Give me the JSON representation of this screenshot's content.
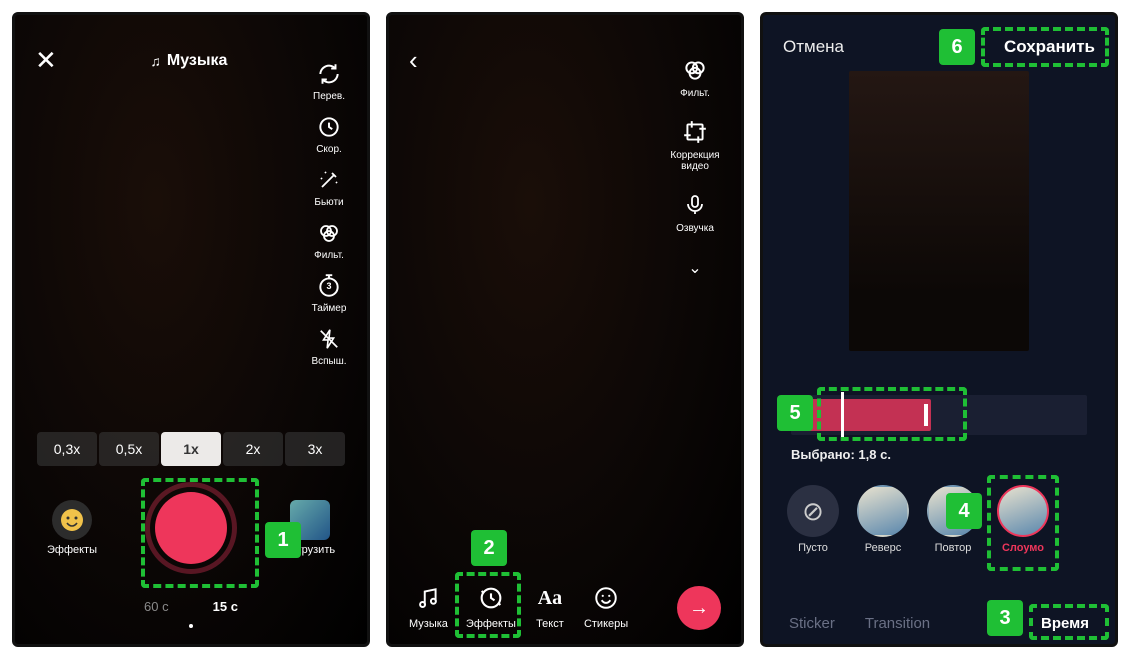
{
  "callouts": {
    "n1": "1",
    "n2": "2",
    "n3": "3",
    "n4": "4",
    "n5": "5",
    "n6": "6"
  },
  "p1": {
    "music": "Музыка",
    "tools": {
      "flip": "Перев.",
      "speed": "Скор.",
      "beauty": "Бьюти",
      "filter": "Фильт.",
      "timer": "Таймер",
      "timer_value": "3",
      "flash": "Вспыш."
    },
    "speeds": {
      "s03": "0,3x",
      "s05": "0,5x",
      "s1": "1x",
      "s2": "2x",
      "s3": "3x"
    },
    "effects_btn": "Эффекты",
    "upload_btn": "Загрузить",
    "dur60": "60 с",
    "dur15": "15 с"
  },
  "p2": {
    "tools": {
      "filter": "Фильт.",
      "correction": "Коррекция видео",
      "voice": "Озвучка"
    },
    "edit": {
      "music": "Музыка",
      "effects": "Эффекты",
      "text": "Текст",
      "stickers": "Стикеры"
    }
  },
  "p3": {
    "cancel": "Отмена",
    "save": "Сохранить",
    "selected_label": "Выбрано: 1,8 с.",
    "fx": {
      "none": "Пусто",
      "reverse": "Реверс",
      "repeat": "Повтор",
      "slowmo": "Слоумо"
    },
    "tabs": {
      "sticker": "Sticker",
      "transition": "Transition",
      "time": "Время"
    }
  }
}
